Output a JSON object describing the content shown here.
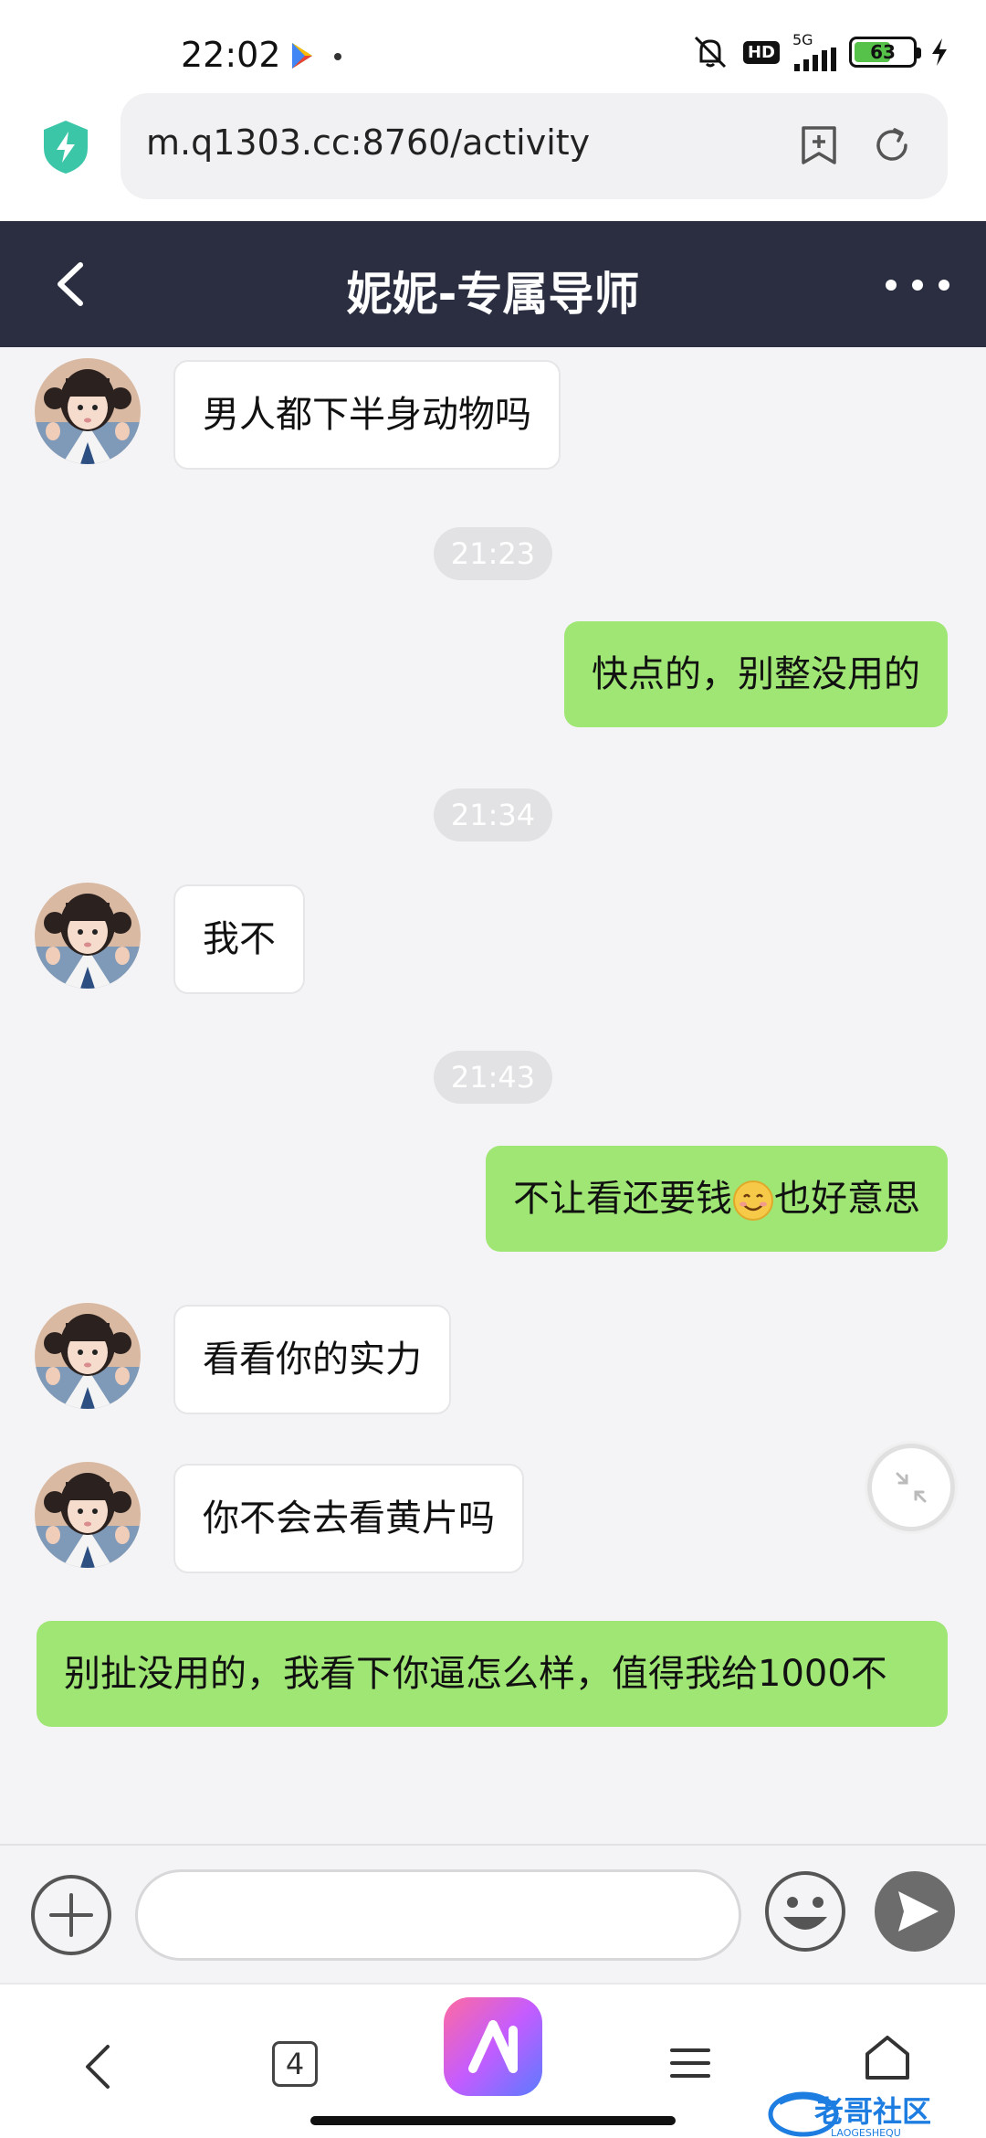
{
  "status_bar": {
    "time": "22:02",
    "network_type": "5G",
    "hd_badge": "HD",
    "battery_level": "63",
    "battery_fraction": 0.63
  },
  "browser": {
    "url": "m.q1303.cc:8760/activity",
    "tab_count": "4"
  },
  "chat": {
    "title": "妮妮-专属导师"
  },
  "messages": [
    {
      "side": "left",
      "text": "男人都下半身动物吗"
    },
    {
      "time": "21:23"
    },
    {
      "side": "right",
      "text": "快点的，别整没用的"
    },
    {
      "time": "21:34"
    },
    {
      "side": "left",
      "text": "我不"
    },
    {
      "time": "21:43"
    },
    {
      "side": "right",
      "text_before": "不让看还要钱",
      "emoji": "smiling-face",
      "text_after": "也好意思"
    },
    {
      "side": "left",
      "text": "看看你的实力"
    },
    {
      "side": "left",
      "text": "你不会去看黄片吗"
    },
    {
      "side": "right",
      "text": "别扯没用的，我看下你逼怎么样，值得我给1000不"
    }
  ],
  "input": {
    "placeholder": ""
  },
  "watermark": {
    "text": "老哥社区",
    "subtext": "LAOGESHEQU"
  },
  "colors": {
    "header_bg": "#2a2e40",
    "sent_bubble": "#9fe674",
    "received_bubble": "#ffffff",
    "chat_bg": "#f4f4f6"
  }
}
